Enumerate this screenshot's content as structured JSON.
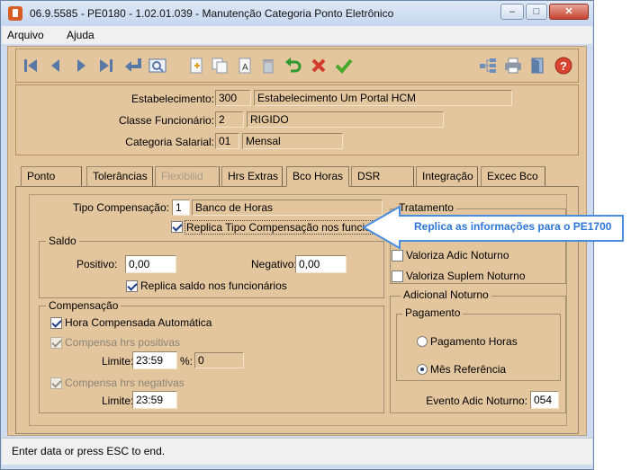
{
  "window": {
    "title": "06.9.5585 - PE0180 - 1.02.01.039 - Manutenção Categoria Ponto Eletrônico"
  },
  "menu": {
    "items": [
      "Arquivo",
      "Ajuda"
    ]
  },
  "toolbar": {
    "buttons": [
      "first-record",
      "previous-record",
      "next-record",
      "last-record",
      "goto-record",
      "search",
      "add",
      "copy",
      "modify",
      "delete",
      "undo",
      "cancel",
      "save",
      "tree",
      "print",
      "exit",
      "help"
    ]
  },
  "header": {
    "estabelecimento": {
      "label": "Estabelecimento:",
      "code": "300",
      "name": "Estabelecimento Um Portal HCM"
    },
    "classe": {
      "label": "Classe Funcionário:",
      "code": "2",
      "name": "RIGIDO"
    },
    "categoria": {
      "label": "Categoria Salarial:",
      "code": "01",
      "name": "Mensal"
    }
  },
  "tabs": [
    {
      "label": "Ponto",
      "state": "normal"
    },
    {
      "label": "Tolerâncias",
      "state": "normal"
    },
    {
      "label": "Flexibilid",
      "state": "disabled"
    },
    {
      "label": "Hrs Extras",
      "state": "normal"
    },
    {
      "label": "Bco Horas",
      "state": "active"
    },
    {
      "label": "DSR",
      "state": "normal"
    },
    {
      "label": "Integração",
      "state": "normal"
    },
    {
      "label": "Excec Bco",
      "state": "normal"
    }
  ],
  "bco_horas": {
    "tipo_compensacao": {
      "label": "Tipo Compensação:",
      "code": "1",
      "name": "Banco de Horas"
    },
    "replica_tipo": {
      "label": "Replica Tipo Compensação nos funcionários",
      "checked": true
    },
    "saldo": {
      "title": "Saldo",
      "positivo_label": "Positivo:",
      "positivo_value": "0,00",
      "negativo_label": "Negativo:",
      "negativo_value": "0,00",
      "replica_label": "Replica saldo nos funcionários",
      "replica_checked": true
    },
    "compensacao": {
      "title": "Compensação",
      "hora_auto_label": "Hora Compensada Automática",
      "hora_auto_checked": true,
      "positivas_label": "Compensa hrs positivas",
      "positivas_checked": true,
      "limite1_label": "Limite:",
      "limite1_value": "23:59",
      "pct_label": "%:",
      "pct_value": "0",
      "negativas_label": "Compensa hrs negativas",
      "negativas_checked": true,
      "limite2_label": "Limite:",
      "limite2_value": "23:59"
    },
    "tratamento": {
      "title": "Tratamento",
      "valoriza_adic_label": "Valoriza Adic Noturno",
      "valoriza_adic_checked": false,
      "valoriza_suplem_label": "Valoriza Suplem Noturno",
      "valoriza_suplem_checked": false
    },
    "adicional_noturno": {
      "title": "Adicional Noturno",
      "pagamento_title": "Pagamento",
      "options": [
        "Pagamento Horas",
        "Mês Referência"
      ],
      "selected": "Mês Referência",
      "evento_label": "Evento Adic Noturno:",
      "evento_value": "054"
    }
  },
  "callout": {
    "text": "Replica as informações para o PE1700",
    "color": "#2c76d8"
  },
  "status": {
    "text": "Enter data or press ESC to end."
  }
}
